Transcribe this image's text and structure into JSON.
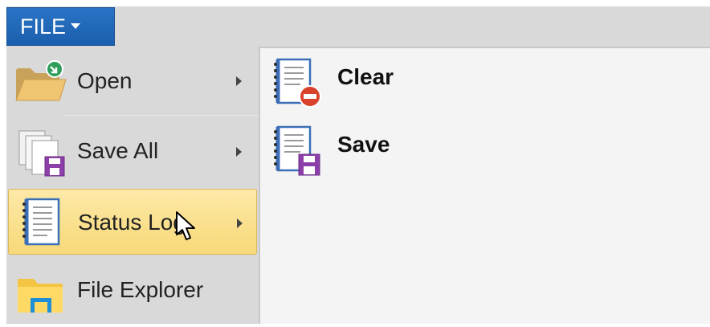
{
  "file_tab": {
    "label": "FILE"
  },
  "menu": {
    "items": [
      {
        "label": "Open",
        "icon": "folder-open-icon",
        "has_submenu": true
      },
      {
        "label": "Save All",
        "icon": "save-all-icon",
        "has_submenu": true
      },
      {
        "label": "Status Log",
        "icon": "status-log-icon",
        "has_submenu": true,
        "highlighted": true
      },
      {
        "label": "File Explorer",
        "icon": "file-explorer-icon",
        "has_submenu": false
      }
    ]
  },
  "submenu": {
    "items": [
      {
        "label": "Clear",
        "icon": "clear-log-icon"
      },
      {
        "label": "Save",
        "icon": "save-log-icon"
      }
    ]
  },
  "colors": {
    "file_tab": "#1b5fae",
    "menu_bg": "#d9d9d9",
    "highlight": "#f7d978",
    "panel_bg": "#f4f4f4"
  }
}
